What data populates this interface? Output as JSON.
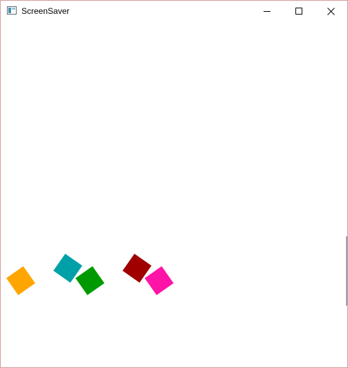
{
  "window": {
    "title": "ScreenSaver",
    "controls": {
      "minimize_icon": "minimize-icon",
      "maximize_icon": "maximize-icon",
      "close_icon": "close-icon"
    }
  },
  "canvas": {
    "background": "#ffffff",
    "squares": [
      {
        "color_name": "orange",
        "color": "#ffa500"
      },
      {
        "color_name": "teal",
        "color": "#00a0a8"
      },
      {
        "color_name": "green",
        "color": "#009a00"
      },
      {
        "color_name": "dark-red",
        "color": "#a00000"
      },
      {
        "color_name": "magenta",
        "color": "#ff14a8"
      }
    ]
  }
}
